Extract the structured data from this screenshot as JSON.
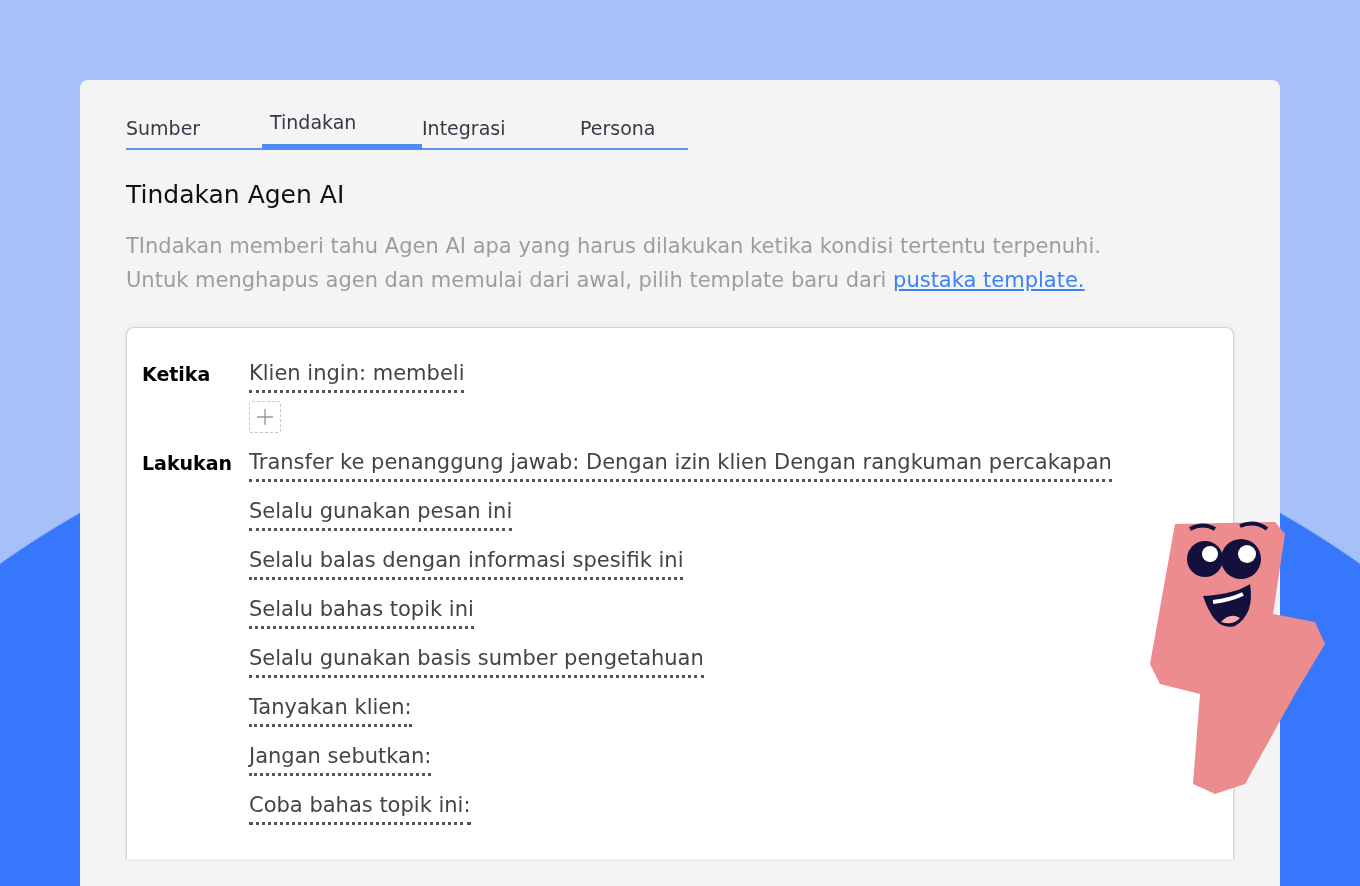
{
  "tabs": [
    {
      "label": "Sumber",
      "selected": false
    },
    {
      "label": "Tindakan",
      "selected": true
    },
    {
      "label": "Integrasi",
      "selected": false
    },
    {
      "label": "Persona",
      "selected": false
    }
  ],
  "section": {
    "title": "Tindakan Agen AI",
    "description_lines": [
      "TIndakan memberi tahu Agen AI apa yang harus dilakukan ketika kondisi tertentu terpenuhi.",
      "Untuk menghapus agen dan memulai dari awal, pilih template baru dari "
    ],
    "link": "pustaka template."
  },
  "rule": [
    {
      "label": "Ketika",
      "items": [
        "Klien ingin: membeli"
      ],
      "can_add": true
    },
    {
      "label": "Lakukan",
      "items": [
        "Transfer ke penanggung jawab: Dengan izin klien Dengan rangkuman percakapan",
        "Selalu gunakan pesan ini",
        "Selalu balas dengan informasi spesifik ini",
        "Selalu bahas topik ini",
        "Selalu gunakan basis sumber pengetahuan",
        "Tanyakan klien:",
        "Jangan sebutkan:",
        "Coba bahas topik ini:"
      ],
      "can_add": false
    }
  ]
}
